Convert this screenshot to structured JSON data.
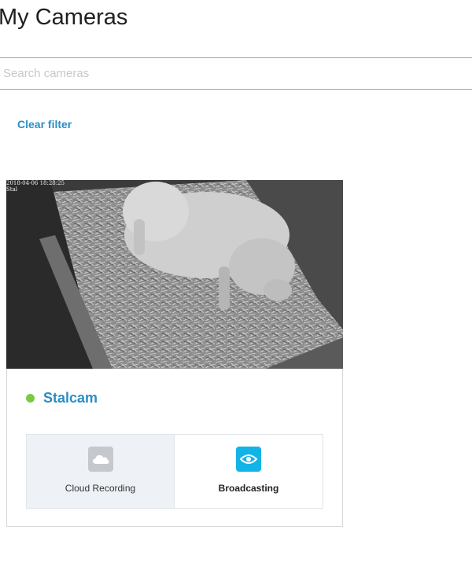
{
  "page": {
    "title": "My Cameras"
  },
  "search": {
    "placeholder": "Search cameras",
    "value": ""
  },
  "filter": {
    "clear_label": "Clear filter"
  },
  "camera": {
    "name": "Stalcam",
    "status_color": "#7ac943",
    "thumbnail_overlay": {
      "timestamp": "2018-04-06 18:28:25",
      "label": "Stal"
    },
    "features": [
      {
        "label": "Cloud Recording",
        "icon": "cloud-icon",
        "active": false
      },
      {
        "label": "Broadcasting",
        "icon": "eye-icon",
        "active": true
      }
    ]
  },
  "colors": {
    "accent": "#2b8dc4",
    "broadcast_active": "#12b4e8",
    "online": "#7ac943"
  }
}
